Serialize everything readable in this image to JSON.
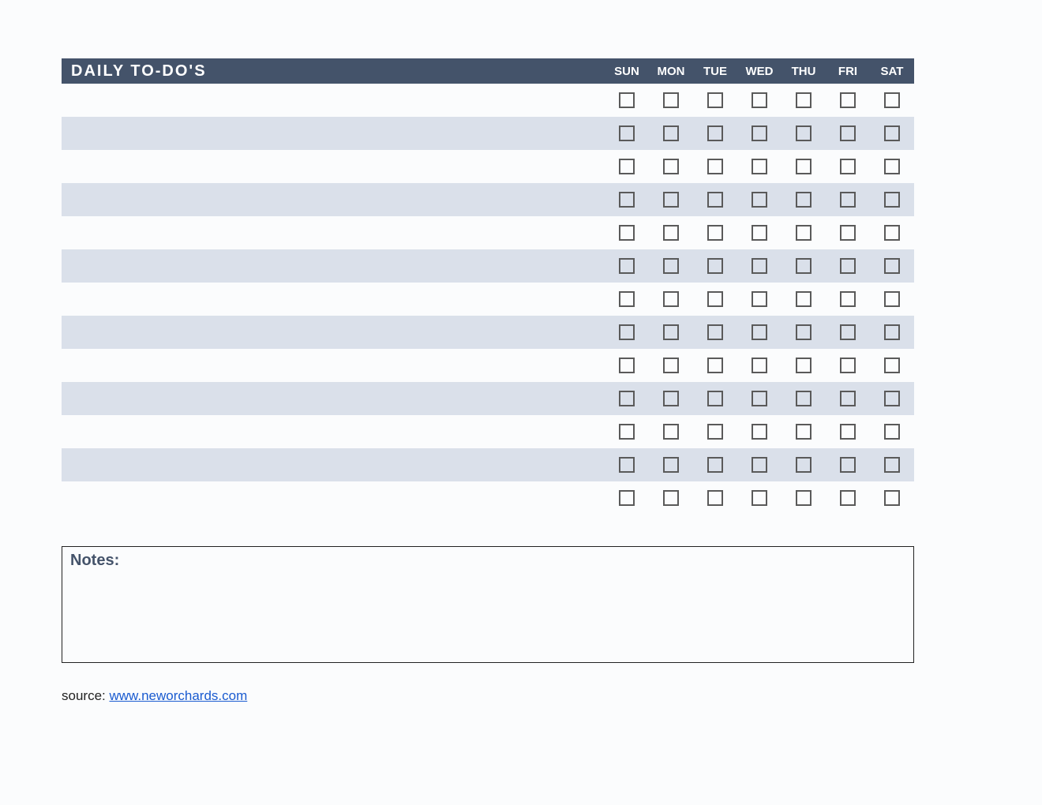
{
  "header": {
    "title": "DAILY TO-DO'S",
    "days": [
      "SUN",
      "MON",
      "TUE",
      "WED",
      "THU",
      "FRI",
      "SAT"
    ]
  },
  "rows": [
    {
      "task": ""
    },
    {
      "task": ""
    },
    {
      "task": ""
    },
    {
      "task": ""
    },
    {
      "task": ""
    },
    {
      "task": ""
    },
    {
      "task": ""
    },
    {
      "task": ""
    },
    {
      "task": ""
    },
    {
      "task": ""
    },
    {
      "task": ""
    },
    {
      "task": ""
    },
    {
      "task": ""
    }
  ],
  "notes": {
    "label": "Notes:",
    "content": ""
  },
  "source": {
    "prefix": "source: ",
    "link_text": "www.neworchards.com"
  }
}
